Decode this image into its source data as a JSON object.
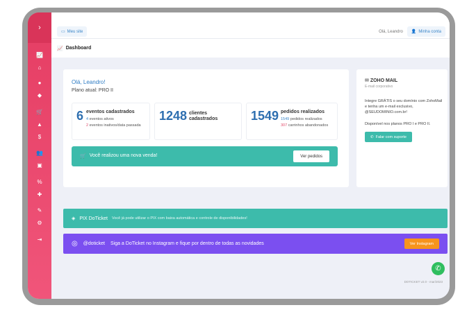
{
  "topbar": {
    "site_label": "Meu site",
    "greeting": "Olá, Leandro",
    "account_label": "Minha conta"
  },
  "breadcrumb": {
    "title": "Dashboard"
  },
  "welcome": {
    "greeting": "Olá, Leandro!",
    "plan": "Plano atual: PRO II"
  },
  "stats": [
    {
      "number": "6",
      "label": "eventos cadastrados",
      "line1_num": "4",
      "line1": "eventos ativos",
      "line2_num": "2",
      "line2": "eventos inativos/data passada"
    },
    {
      "number": "1248",
      "label": "clientes cadastrados"
    },
    {
      "number": "1549",
      "label": "pedidos realizados",
      "line1_num": "1549",
      "line1": "pedidos realizados",
      "line2_num": "307",
      "line2": "carrinhos abandonados"
    }
  ],
  "sale_alert": {
    "text": "Você realizou uma nova venda!",
    "button": "Ver pedidos"
  },
  "zoho": {
    "title": "ZOHO MAIL",
    "subtitle": "E-mail corporativo",
    "description": "Integre GRÁTIS o seu domínio com ZohoMail e tenha um e-mail exclusivo, @SEUDOMINIO.com.br!",
    "availability": "Disponível nos planos PRO I e PRO II.",
    "button": "Falar com suporte"
  },
  "pix": {
    "title": "PIX DoTicket",
    "description": "Você já pode utilizar o PIX com baixa automática e controle de disponibilidades!"
  },
  "instagram": {
    "handle": "@doticket",
    "text": "Siga a DoTicket no Instagram e fique por dentro de todas as novidades",
    "button": "Ver Instagram"
  },
  "footer": {
    "text": "DOTICKET v2.0 - mar/2023"
  },
  "colors": {
    "sidebar": "#e53d63",
    "teal": "#3dbbab",
    "purple": "#7b4ff0",
    "orange": "#f7941d",
    "blue": "#2e6fb0"
  },
  "icons": [
    "menu-expand-icon",
    "chart-icon",
    "home-icon",
    "clock-icon",
    "tag-icon",
    "cart-icon",
    "warning-icon",
    "dollar-icon",
    "users-icon",
    "clipboard-icon",
    "percent-icon",
    "puzzle-icon",
    "brush-icon",
    "settings-icon",
    "logout-icon",
    "whatsapp-icon",
    "instagram-icon",
    "pix-icon"
  ]
}
